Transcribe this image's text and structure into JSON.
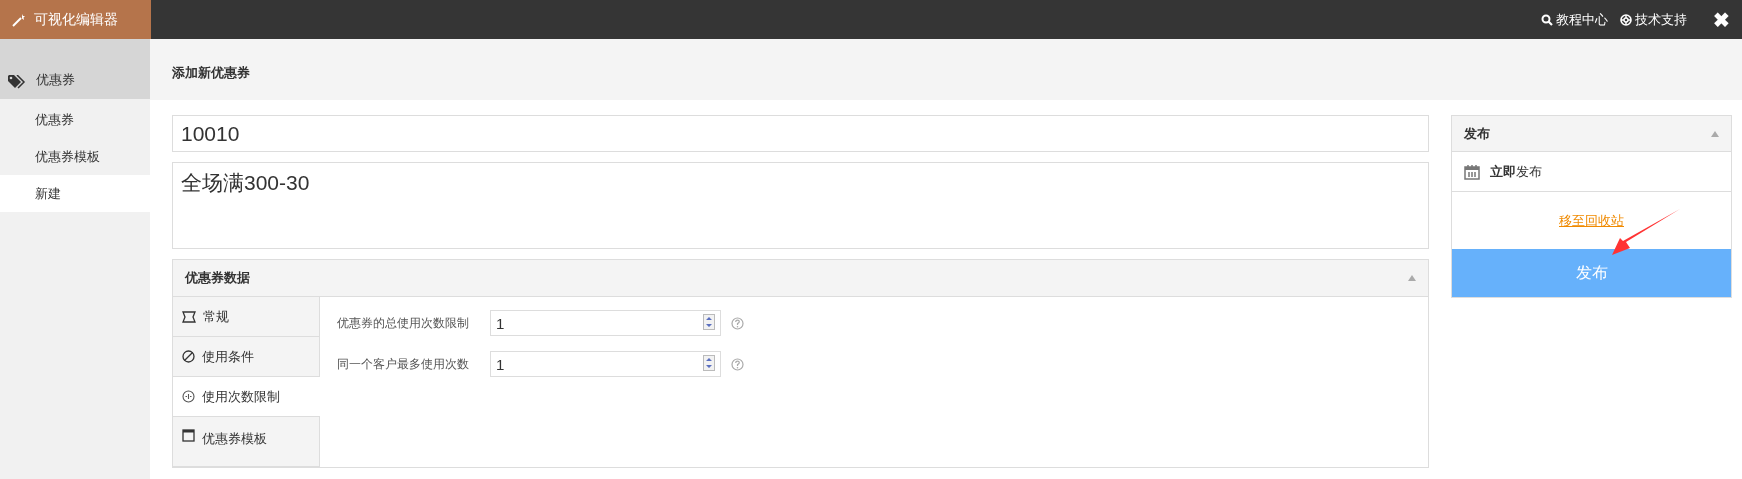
{
  "topbar": {
    "brand": "可视化编辑器",
    "links": [
      {
        "kind": "search",
        "label": "教程中心"
      },
      {
        "kind": "support",
        "label": "技术支持"
      }
    ],
    "close": "✖"
  },
  "sidebar": {
    "section": "优惠券",
    "items": [
      {
        "label": "优惠券",
        "selected": false
      },
      {
        "label": "优惠券模板",
        "selected": false
      },
      {
        "label": "新建",
        "selected": true
      }
    ]
  },
  "page_title": "添加新优惠券",
  "code_field": {
    "value": "10010"
  },
  "description_field": {
    "value": "全场满300-30"
  },
  "coupon_data": {
    "title": "优惠券数据",
    "expanded": true,
    "tabs": [
      {
        "kind": "ticket",
        "label": "常规",
        "selected": false
      },
      {
        "kind": "ban",
        "label": "使用条件",
        "selected": false
      },
      {
        "kind": "limit",
        "label": "使用次数限制",
        "selected": true
      },
      {
        "kind": "window",
        "label": "优惠券模板",
        "selected": false
      }
    ],
    "fields": [
      {
        "label": "优惠券的总使用次数限制",
        "value": "1"
      },
      {
        "label": "同一个客户最多使用次数",
        "value": "1"
      }
    ]
  },
  "publish_box": {
    "title": "发布",
    "expanded": true,
    "schedule": "**立即**发布",
    "trash_link": "移至回收站",
    "publish_button": "发布"
  }
}
